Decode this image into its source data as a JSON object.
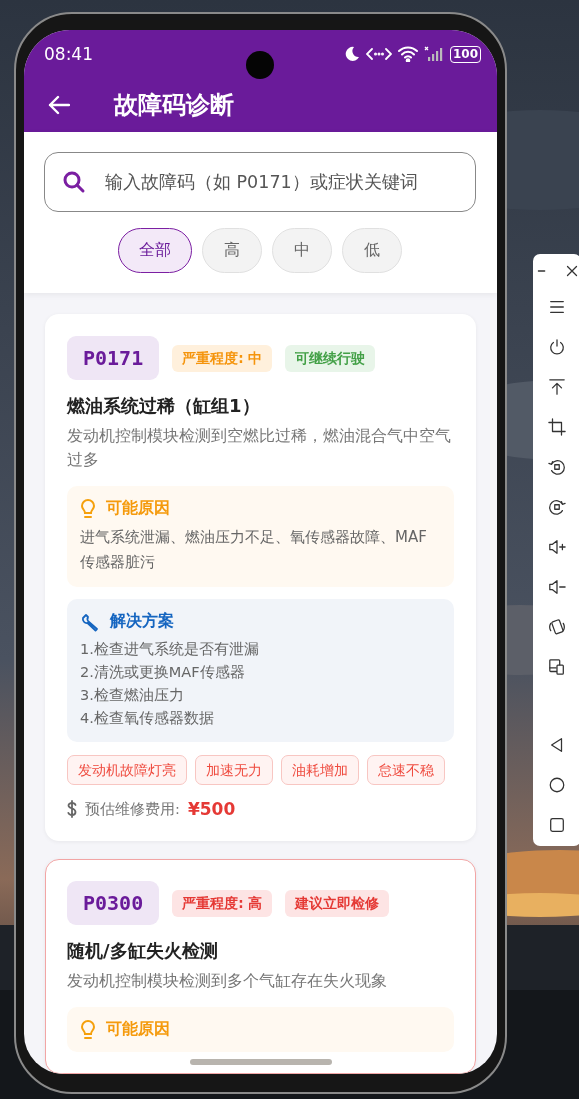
{
  "status_bar": {
    "time": "08:41",
    "battery": "100"
  },
  "app_bar": {
    "title": "故障码诊断"
  },
  "search": {
    "placeholder": "输入故障码（如 P0171）或症状关键词"
  },
  "filters": [
    {
      "label": "全部",
      "selected": true
    },
    {
      "label": "高",
      "selected": false
    },
    {
      "label": "中",
      "selected": false
    },
    {
      "label": "低",
      "selected": false
    }
  ],
  "codes": [
    {
      "code": "P0171",
      "kind": "medium",
      "severity_label": "严重程度: 中",
      "advice": "可继续行驶",
      "title": "燃油系统过稀（缸组1）",
      "description": "发动机控制模块检测到空燃比过稀，燃油混合气中空气过多",
      "causes": {
        "heading": "可能原因",
        "text": "进气系统泄漏、燃油压力不足、氧传感器故障、MAF传感器脏污"
      },
      "solutions": {
        "heading": "解决方案",
        "steps": [
          "1.检查进气系统是否有泄漏",
          "2.清洗或更换MAF传感器",
          "3.检查燃油压力",
          "4.检查氧传感器数据"
        ]
      },
      "symptoms": [
        "发动机故障灯亮",
        "加速无力",
        "油耗增加",
        "怠速不稳"
      ],
      "cost": {
        "label": "预估维修费用:",
        "value": "¥500"
      }
    },
    {
      "code": "P0300",
      "kind": "high",
      "severity_label": "严重程度: 高",
      "advice": "建议立即检修",
      "title": "随机/多缸失火检测",
      "description": "发动机控制模块检测到多个气缸存在失火现象",
      "causes": {
        "heading": "可能原因"
      }
    }
  ]
}
